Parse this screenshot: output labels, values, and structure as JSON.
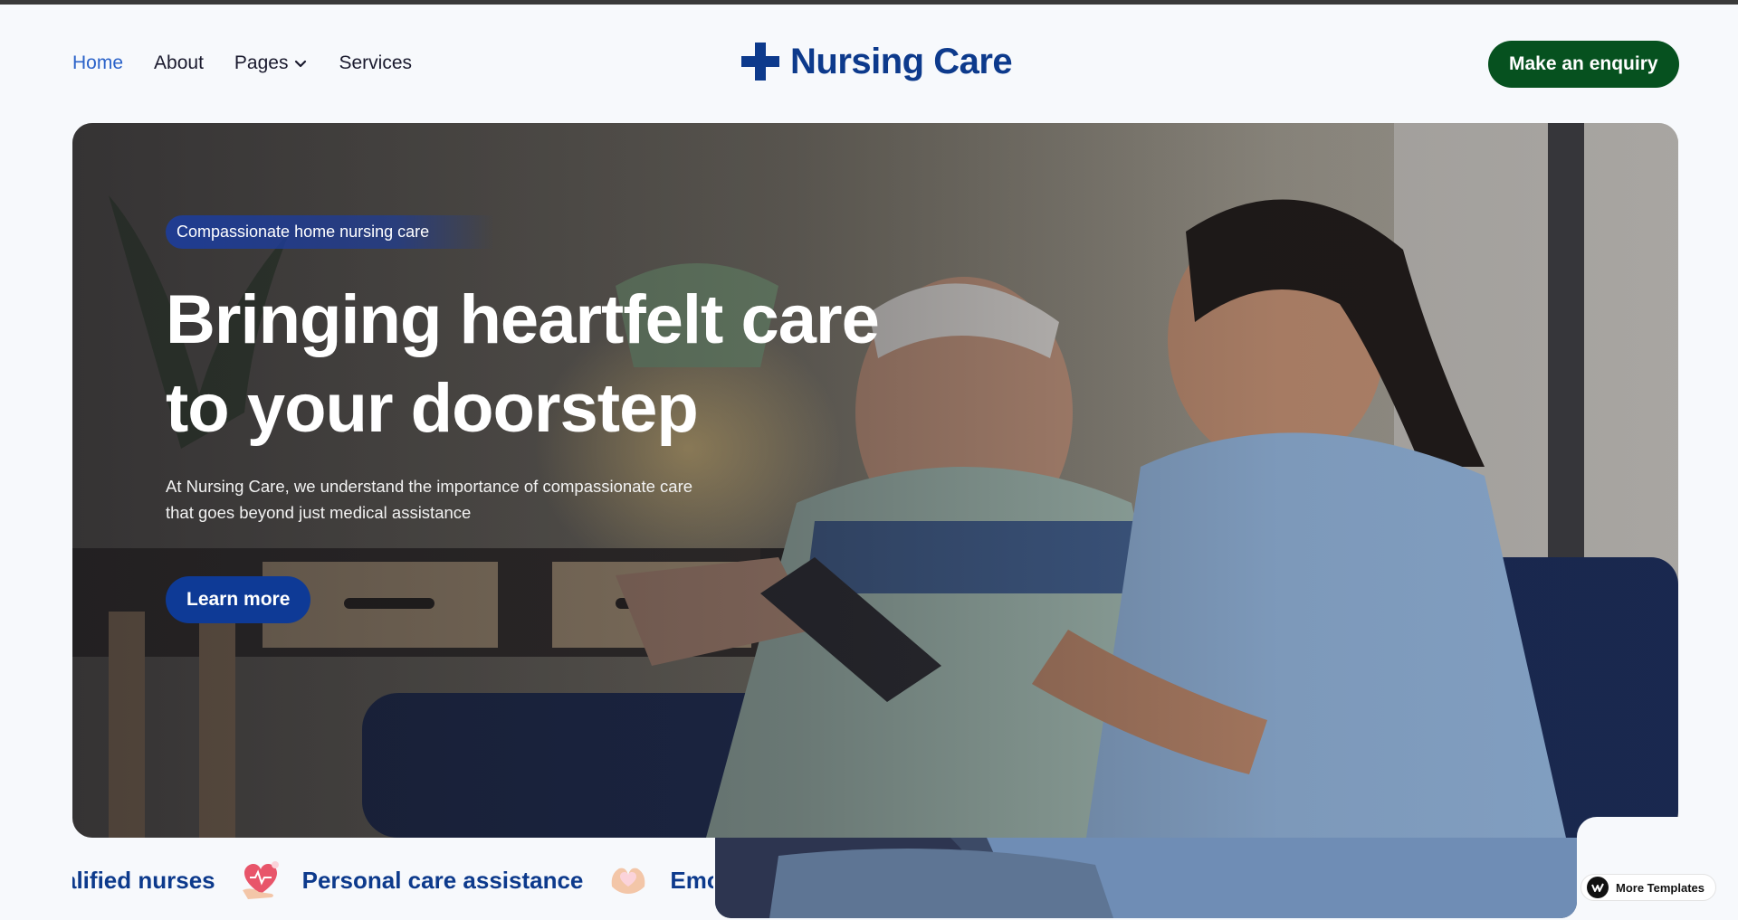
{
  "nav": {
    "links": [
      {
        "label": "Home",
        "active": true
      },
      {
        "label": "About",
        "active": false
      },
      {
        "label": "Pages",
        "active": false,
        "has_dropdown": true
      },
      {
        "label": "Services",
        "active": false
      }
    ],
    "logo_text": "Nursing Care",
    "logo_icon": "medical-cross-icon",
    "enquiry_label": "Make an enquiry"
  },
  "hero": {
    "tag": "Compassionate home nursing care",
    "title_line1": "Bringing heartfelt care",
    "title_line2": "to your doorstep",
    "description": "At Nursing Care, we understand the importance of compassionate care that goes beyond just medical assistance",
    "cta_label": "Learn more"
  },
  "marquee": {
    "items": [
      {
        "label": "alified nurses",
        "icon": null
      },
      {
        "label": "Personal care assistance",
        "icon": "heart-hand-icon"
      },
      {
        "label": "Emot",
        "icon": "heart-hands-icon"
      }
    ]
  },
  "badge": {
    "label": "More Templates",
    "icon": "webflow-icon"
  },
  "colors": {
    "brand_blue": "#0d3a8c",
    "active_link": "#2a62c9",
    "enquiry_green": "#06511f",
    "cta_blue": "#0e3a96",
    "page_bg": "#f7f9fc"
  }
}
